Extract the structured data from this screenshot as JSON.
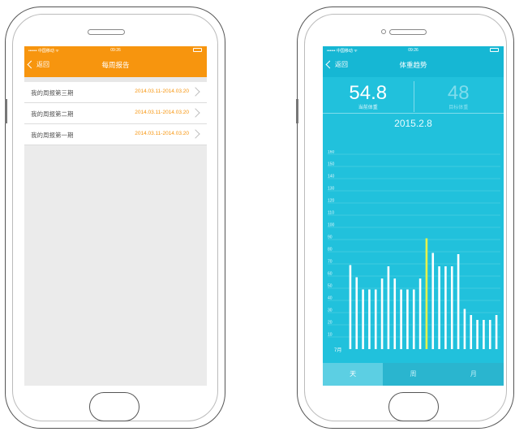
{
  "left_screen": {
    "status_bar": {
      "signal": "•••••• 中国移动 ᯤ",
      "time": "09:26"
    },
    "nav": {
      "back_label": "返回",
      "title": "每周报告"
    },
    "reports": [
      {
        "name": "我的周报第三期",
        "range": "2014.03.11-2014.03.20"
      },
      {
        "name": "我的周报第二期",
        "range": "2014.03.11-2014.03.20"
      },
      {
        "name": "我的周报第一期",
        "range": "2014.03.11-2014.03.20"
      }
    ],
    "colors": {
      "accent": "#f7950e",
      "background": "#ebebeb"
    }
  },
  "right_screen": {
    "status_bar": {
      "signal": "•••••• 中国移动 ᯤ",
      "time": "09:26"
    },
    "nav": {
      "back_label": "返回",
      "title": "体重趋势"
    },
    "current_weight": {
      "value": "54.8",
      "label": "当前体重"
    },
    "target_weight": {
      "value": "48",
      "label": "目标体重"
    },
    "date": "2015.2.8",
    "tabs": [
      "天",
      "周",
      "月"
    ],
    "active_tab": "天",
    "colors": {
      "background": "#21c1dc",
      "bar": "#ffffff",
      "highlight_bar": "#e6f24a"
    }
  },
  "chart_data": {
    "type": "bar",
    "ylim": [
      0,
      160
    ],
    "y_ticks": [
      10,
      20,
      30,
      40,
      50,
      60,
      70,
      80,
      90,
      100,
      110,
      120,
      130,
      140,
      150,
      160
    ],
    "x_month_label": "7月",
    "highlight_index": 12,
    "values": [
      69,
      59,
      49,
      49,
      49,
      58,
      68,
      58,
      49,
      49,
      49,
      58,
      91,
      79,
      68,
      68,
      68,
      78,
      33,
      28,
      24,
      24,
      24,
      28
    ]
  }
}
